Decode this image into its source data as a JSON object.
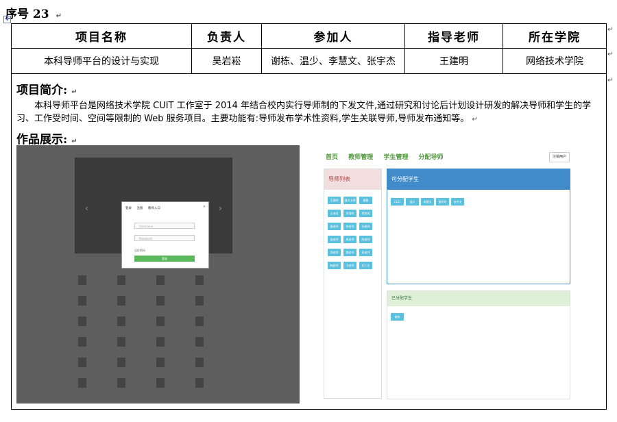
{
  "seq_label": "序号 23",
  "table": {
    "headers": [
      "项目名称",
      "负责人",
      "参加人",
      "指导老师",
      "所在学院"
    ],
    "values": [
      "本科导师平台的设计与实现",
      "吴岩崧",
      "谢栋、温少、李慧文、张宇杰",
      "王建明",
      "网络技术学院"
    ]
  },
  "intro": {
    "title": "项目简介:",
    "text": "本科导师平台是网络技术学院 CUIT 工作室于 2014 年结合校内实行导师制的下发文件,通过研究和讨论后计划设计研发的解决导师和学生的学习、工作受时间、空间等限制的 Web 服务项目。主要功能有:导师发布学术性资料,学生关联导师,导师发布通知等。"
  },
  "showcase": {
    "title": "作品展示:",
    "left_shot": {
      "login_tabs": [
        "登录",
        "注册",
        "教师入口"
      ],
      "username_placeholder": "Username",
      "password_placeholder": "Password",
      "remember": "记住密码",
      "login_button": "登录"
    },
    "right_shot": {
      "nav": [
        "首页",
        "教师管理",
        "学生管理",
        "分配导师"
      ],
      "logout": "注销用户",
      "teacher_list_title": "导师列表",
      "assignable_title": "可分配学生",
      "assigned_title": "已分配学生",
      "teacher_buttons": [
        "王建明",
        "潘大卡德",
        "谢雅",
        "王海涛",
        "李海明",
        "罗胜成",
        "唐老师",
        "李老师",
        "孙老师",
        "张老师",
        "周老师",
        "陈老师",
        "郑老师",
        "魏老师",
        "蒋老师",
        "韩老师",
        "冯老师",
        "杜三丰"
      ],
      "assignable_students": [
        "2121",
        "温少",
        "李慧文",
        "谢玲玲",
        "张宇文"
      ],
      "assigned_students": [
        "谢栋"
      ]
    }
  }
}
